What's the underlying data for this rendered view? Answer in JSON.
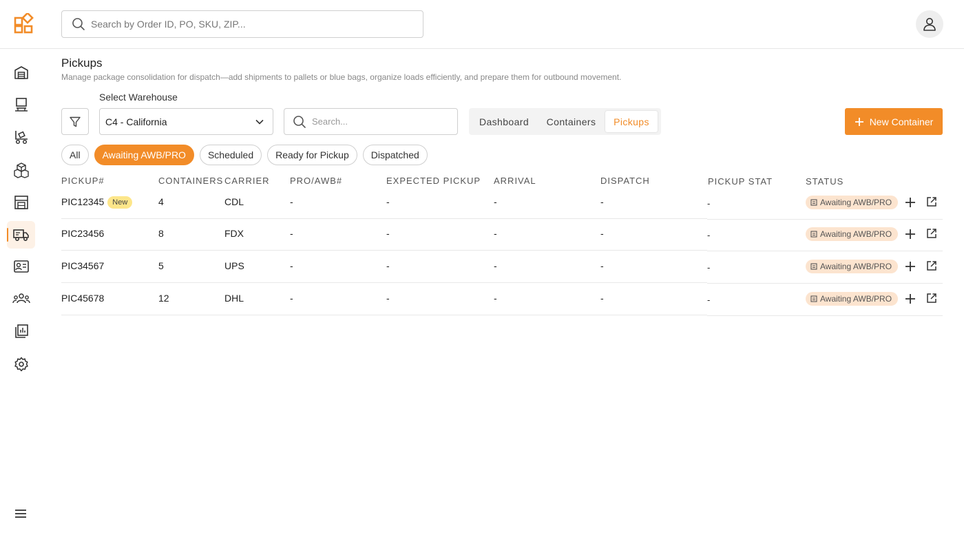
{
  "header": {
    "search_placeholder": "Search by Order ID, PO, SKU, ZIP..."
  },
  "colors": {
    "accent": "#f28c28",
    "badge_new_bg": "#fde68a",
    "status_bg": "#fce4cf"
  },
  "sidebar": {
    "items": [
      {
        "icon": "warehouse-icon"
      },
      {
        "icon": "workstation-icon"
      },
      {
        "icon": "dock-icon"
      },
      {
        "icon": "packages-icon"
      },
      {
        "icon": "shelving-icon"
      },
      {
        "icon": "truck-icon",
        "active": true
      },
      {
        "icon": "contact-card-icon"
      },
      {
        "icon": "users-icon"
      },
      {
        "icon": "reports-icon"
      },
      {
        "icon": "settings-icon"
      }
    ],
    "menu_icon": "hamburger-icon"
  },
  "page": {
    "title": "Pickups",
    "subtitle": "Manage package consolidation for dispatch—add shipments to pallets or blue bags, organize loads efficiently, and prepare them for outbound movement.",
    "warehouse_label": "Select Warehouse",
    "warehouse_value": "C4 - California",
    "search_placeholder": "Search...",
    "tabs": [
      "Dashboard",
      "Containers",
      "Pickups"
    ],
    "active_tab": "Pickups",
    "new_button": "New Container"
  },
  "filters": {
    "chips": [
      "All",
      "Awaiting AWB/PRO",
      "Scheduled",
      "Ready for Pickup",
      "Dispatched"
    ],
    "active": "Awaiting AWB/PRO"
  },
  "table": {
    "columns": [
      "PICKUP#",
      "CONTAINERS",
      "CARRIER",
      "PRO/AWB#",
      "EXPECTED PICKUP",
      "ARRIVAL",
      "DISPATCH",
      "PICKUP STAT",
      "STATUS"
    ],
    "rows": [
      {
        "pickup": "PIC12345",
        "badge": "New",
        "containers": "4",
        "carrier": "CDL",
        "pro": "-",
        "expected": "-",
        "arrival": "-",
        "dispatch": "-",
        "pickup_stat": "-",
        "status": "Awaiting AWB/PRO"
      },
      {
        "pickup": "PIC23456",
        "badge": "",
        "containers": "8",
        "carrier": "FDX",
        "pro": "-",
        "expected": "-",
        "arrival": "-",
        "dispatch": "-",
        "pickup_stat": "-",
        "status": "Awaiting AWB/PRO"
      },
      {
        "pickup": "PIC34567",
        "badge": "",
        "containers": "5",
        "carrier": "UPS",
        "pro": "-",
        "expected": "-",
        "arrival": "-",
        "dispatch": "-",
        "pickup_stat": "-",
        "status": "Awaiting AWB/PRO"
      },
      {
        "pickup": "PIC45678",
        "badge": "",
        "containers": "12",
        "carrier": "DHL",
        "pro": "-",
        "expected": "-",
        "arrival": "-",
        "dispatch": "-",
        "pickup_stat": "-",
        "status": "Awaiting AWB/PRO"
      }
    ]
  }
}
